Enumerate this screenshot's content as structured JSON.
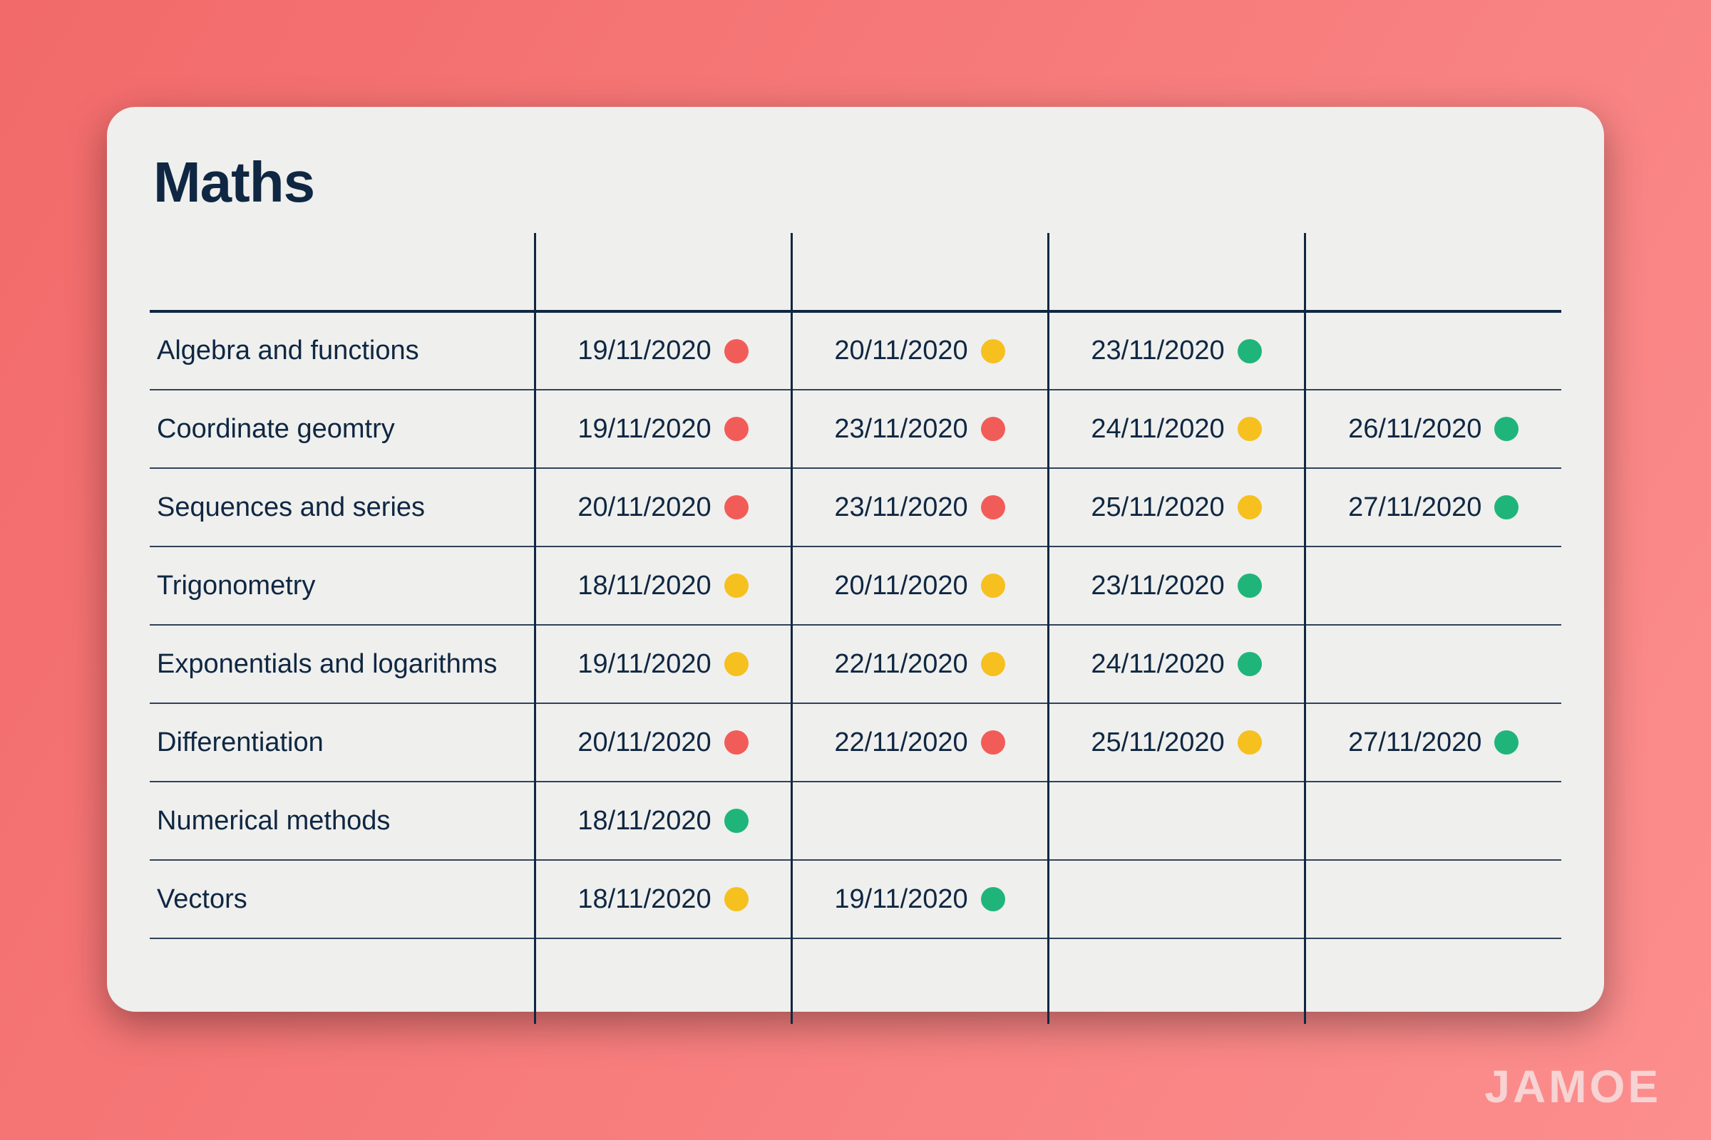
{
  "brand": "JAMOE",
  "card": {
    "title": "Maths",
    "status_colors": {
      "red": "#f25c58",
      "yellow": "#f6c01f",
      "green": "#1fb57a"
    },
    "columns": 4,
    "rows": [
      {
        "topic": "Algebra and functions",
        "entries": [
          {
            "date": "19/11/2020",
            "status": "red"
          },
          {
            "date": "20/11/2020",
            "status": "yellow"
          },
          {
            "date": "23/11/2020",
            "status": "green"
          }
        ]
      },
      {
        "topic": "Coordinate geomtry",
        "entries": [
          {
            "date": "19/11/2020",
            "status": "red"
          },
          {
            "date": "23/11/2020",
            "status": "red"
          },
          {
            "date": "24/11/2020",
            "status": "yellow"
          },
          {
            "date": "26/11/2020",
            "status": "green"
          }
        ]
      },
      {
        "topic": "Sequences and series",
        "entries": [
          {
            "date": "20/11/2020",
            "status": "red"
          },
          {
            "date": "23/11/2020",
            "status": "red"
          },
          {
            "date": "25/11/2020",
            "status": "yellow"
          },
          {
            "date": "27/11/2020",
            "status": "green"
          }
        ]
      },
      {
        "topic": "Trigonometry",
        "entries": [
          {
            "date": "18/11/2020",
            "status": "yellow"
          },
          {
            "date": "20/11/2020",
            "status": "yellow"
          },
          {
            "date": "23/11/2020",
            "status": "green"
          }
        ]
      },
      {
        "topic": "Exponentials and logarithms",
        "entries": [
          {
            "date": "19/11/2020",
            "status": "yellow"
          },
          {
            "date": "22/11/2020",
            "status": "yellow"
          },
          {
            "date": "24/11/2020",
            "status": "green"
          }
        ]
      },
      {
        "topic": "Differentiation",
        "entries": [
          {
            "date": "20/11/2020",
            "status": "red"
          },
          {
            "date": "22/11/2020",
            "status": "red"
          },
          {
            "date": "25/11/2020",
            "status": "yellow"
          },
          {
            "date": "27/11/2020",
            "status": "green"
          }
        ]
      },
      {
        "topic": "Numerical methods",
        "entries": [
          {
            "date": "18/11/2020",
            "status": "green"
          }
        ]
      },
      {
        "topic": "Vectors",
        "entries": [
          {
            "date": "18/11/2020",
            "status": "yellow"
          },
          {
            "date": "19/11/2020",
            "status": "green"
          }
        ]
      }
    ]
  }
}
